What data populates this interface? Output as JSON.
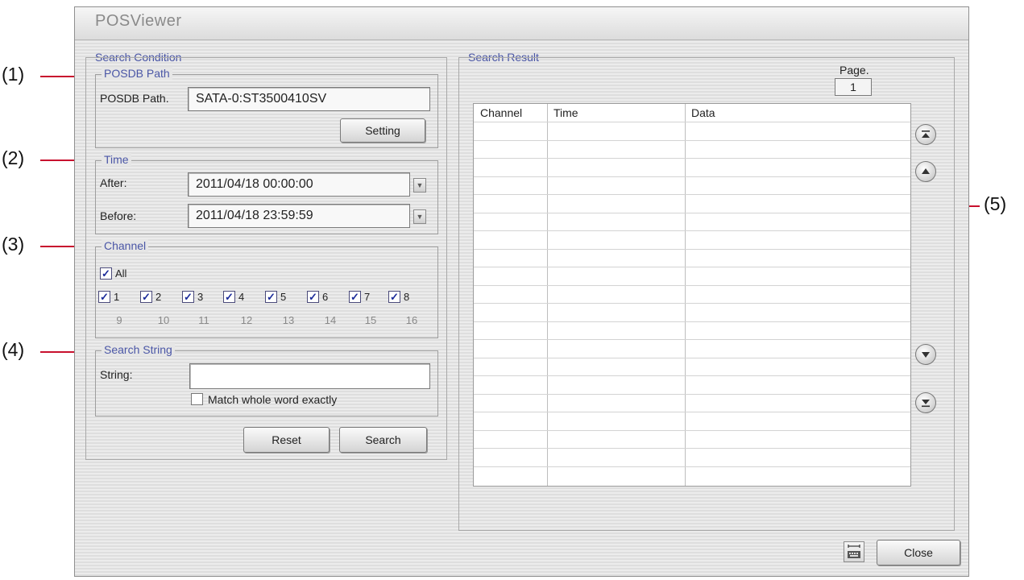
{
  "callouts": [
    "(1)",
    "(2)",
    "(3)",
    "(4)",
    "(5)"
  ],
  "window": {
    "title": "POSViewer"
  },
  "search_condition": {
    "legend": "Search Condition",
    "posdb": {
      "legend": "POSDB Path",
      "label": "POSDB Path.",
      "value": "SATA-0:ST3500410SV",
      "setting_button": "Setting"
    },
    "time": {
      "legend": "Time",
      "after_label": "After:",
      "after_value": "2011/04/18  00:00:00",
      "before_label": "Before:",
      "before_value": "2011/04/18  23:59:59"
    },
    "channel": {
      "legend": "Channel",
      "all_label": "All",
      "all_checked": true,
      "channels_row1": [
        {
          "label": "1",
          "checked": true
        },
        {
          "label": "2",
          "checked": true
        },
        {
          "label": "3",
          "checked": true
        },
        {
          "label": "4",
          "checked": true
        },
        {
          "label": "5",
          "checked": true
        },
        {
          "label": "6",
          "checked": true
        },
        {
          "label": "7",
          "checked": true
        },
        {
          "label": "8",
          "checked": true
        }
      ],
      "channels_row2": [
        "9",
        "10",
        "11",
        "12",
        "13",
        "14",
        "15",
        "16"
      ]
    },
    "search_string": {
      "legend": "Search String",
      "label": "String:",
      "value": "",
      "match_label": "Match whole word exactly",
      "match_checked": false
    },
    "reset_button": "Reset",
    "search_button": "Search"
  },
  "search_result": {
    "legend": "Search Result",
    "page_label": "Page.",
    "page_value": "1",
    "columns": [
      "Channel",
      "Time",
      "Data"
    ],
    "rows": []
  },
  "footer": {
    "close_button": "Close"
  },
  "icons": {
    "nav": [
      "first-page-icon",
      "previous-page-icon",
      "next-page-icon",
      "last-page-icon"
    ],
    "footer": "keyboard-icon",
    "dropdown": "chevron-down-icon",
    "checkbox": "checkmark-icon"
  },
  "colors": {
    "callout_line": "#c8102e",
    "legend_text": "#4a56a6",
    "checkmark": "#1a2a9a"
  }
}
